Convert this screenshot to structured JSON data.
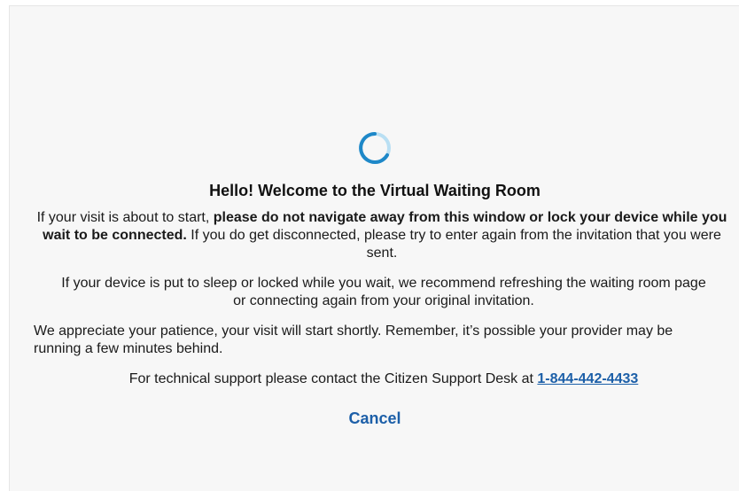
{
  "title": "Hello! Welcome to the Virtual Waiting Room",
  "para1": {
    "pre": "If your visit is about to start, ",
    "bold": "please do not navigate away from this window or lock your device while you wait to be connected.",
    "post": " If you do get disconnected, please try to enter again from the invitation that you were sent."
  },
  "para2": "If your device is put to sleep or locked while you wait, we recommend refreshing the waiting room page or connecting again from your original invitation.",
  "para3": "We appreciate your patience, your visit will start shortly. Remember, it’s possible your provider may be running a few minutes behind.",
  "support": {
    "text": "For technical support please contact the Citizen Support Desk at ",
    "phone": "1-844-442-4433"
  },
  "cancel_label": "Cancel",
  "colors": {
    "spinner_dark": "#1e88c8",
    "spinner_light": "#b9dff3",
    "link": "#1c5fa8"
  },
  "icons": {
    "spinner": "loading-spinner-icon"
  }
}
